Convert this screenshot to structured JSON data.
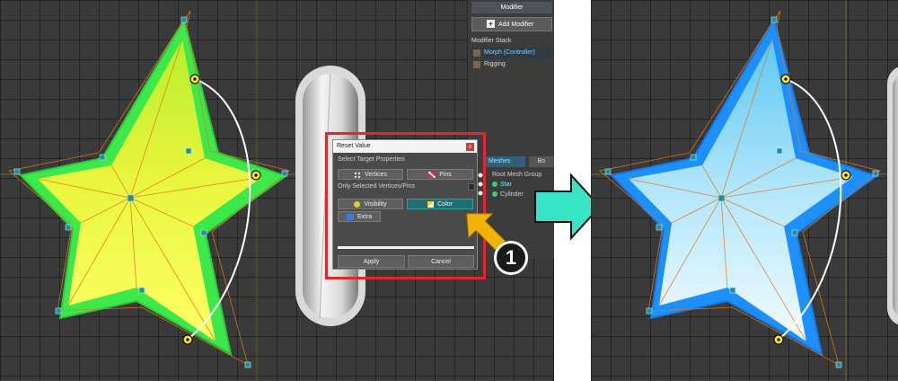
{
  "modifier": {
    "tab_label": "Modifier",
    "add_button_label": "Add Modifier",
    "stack_title": "Modifier Stack",
    "stack_items": [
      {
        "label": "Morph (Controller)",
        "selected": true
      },
      {
        "label": "Rigging",
        "selected": false
      }
    ]
  },
  "meshes_panel": {
    "tabs": [
      {
        "label": "Meshes",
        "active": true
      },
      {
        "label": "Bo",
        "active": false
      }
    ],
    "group_label": "Root Mesh Group",
    "items": [
      {
        "label": "Star",
        "highlight": true
      },
      {
        "label": "Cylinder",
        "highlight": false
      }
    ]
  },
  "reset_dialog": {
    "title": "Reset Value",
    "close_label": "x",
    "section_label": "Select Target Properties",
    "vertices_label": "Vertices",
    "pins_label": "Pins",
    "only_selected_label": "Only Selected Vertices/Pins",
    "visibility_label": "Visibility",
    "color_label": "Color",
    "extra_label": "Extra",
    "apply_label": "Apply",
    "cancel_label": "Cancel"
  },
  "step_badge": {
    "label": "1"
  },
  "colors": {
    "highlight_border": "#e0262e",
    "arrow_cursor": "#f0b400",
    "right_arrow": "#37e5c6",
    "star_before_fill": "#ecf53a",
    "star_before_outline": "#3ce84a",
    "star_after_fill": "#9ee0ff",
    "star_after_outline": "#1e8fff",
    "active_button": "#1f6f70"
  },
  "icons": [
    "plus-icon",
    "morph-icon",
    "rigging-icon",
    "close-icon",
    "vertices-icon",
    "pins-icon",
    "eye-icon",
    "brush-icon",
    "extra-icon",
    "cursor-arrow-icon",
    "right-arrow-icon",
    "control-point-icon",
    "visibility-toggle-icon"
  ]
}
